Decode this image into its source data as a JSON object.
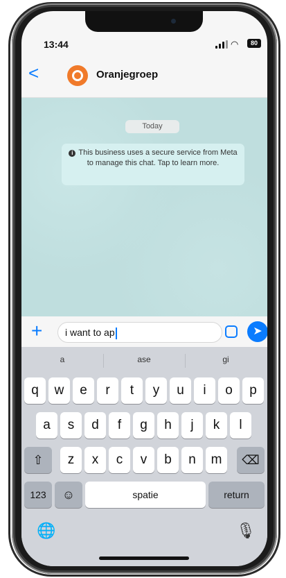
{
  "status": {
    "time": "13:44",
    "battery": "80"
  },
  "header": {
    "back_label": "<",
    "contact_name": "Oranjegroep"
  },
  "chat": {
    "day_badge": "Today",
    "notice": "This business uses a secure service from Meta to manage this chat. Tap to learn more."
  },
  "composer": {
    "text": "i want to ap",
    "plus_label": "+",
    "send_label": "➤"
  },
  "keyboard": {
    "suggestions": [
      "a",
      "ase",
      "gi"
    ],
    "row1": [
      "q",
      "w",
      "e",
      "r",
      "t",
      "y",
      "u",
      "i",
      "o",
      "p"
    ],
    "row2": [
      "a",
      "s",
      "d",
      "f",
      "g",
      "h",
      "j",
      "k",
      "l"
    ],
    "row3": [
      "z",
      "x",
      "c",
      "v",
      "b",
      "n",
      "m"
    ],
    "shift_label": "⇧",
    "delete_label": "⌫",
    "numbers_label": "123",
    "emoji_label": "☺",
    "space_label": "spatie",
    "return_label": "return",
    "globe_label": "🌐",
    "mic_label": "🎙"
  },
  "colors": {
    "accent": "#0a7cff",
    "avatar": "#f07a2a",
    "chat_bg": "#bfdede"
  }
}
